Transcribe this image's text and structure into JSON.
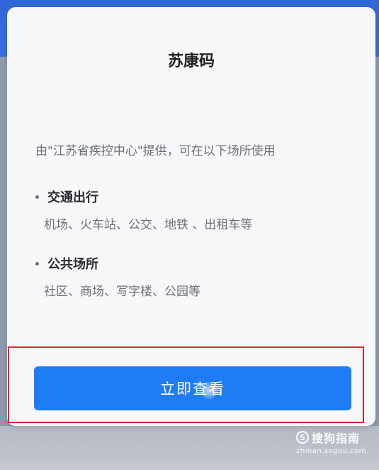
{
  "card": {
    "title": "苏康码",
    "intro": "由\"江苏省疾控中心\"提供，可在以下场所使用",
    "sections": [
      {
        "heading": "交通出行",
        "body": "机场、火车站、公交、地铁 、出租车等"
      },
      {
        "heading": "公共场所",
        "body": "社区、商场、写字楼、公园等"
      }
    ],
    "button_label": "立即查看"
  },
  "watermark": {
    "logo_glyph": "S",
    "text": "搜狗指南",
    "url": "zhinan.sogou.com"
  },
  "colors": {
    "button": "#1f7cf4",
    "highlight": "#e0242a",
    "top_band": "#2f67d6"
  }
}
